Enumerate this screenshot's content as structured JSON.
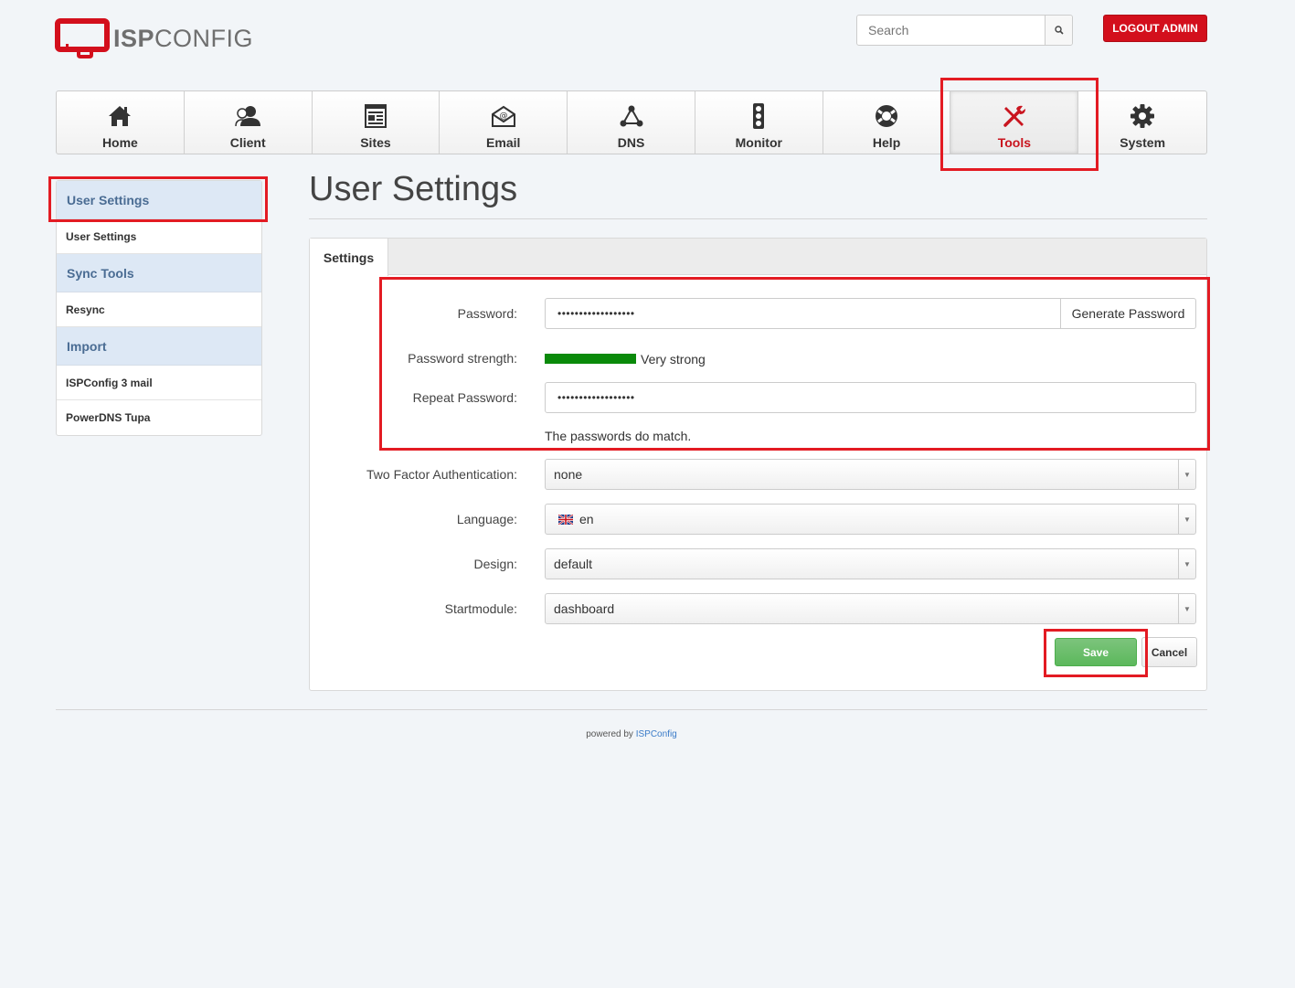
{
  "header": {
    "logo_bold": "ISP",
    "logo_light": "CONFIG",
    "search_placeholder": "Search",
    "logout_label": "LOGOUT ADMIN"
  },
  "nav": {
    "items": [
      {
        "label": "Home",
        "icon": "home-icon"
      },
      {
        "label": "Client",
        "icon": "client-icon"
      },
      {
        "label": "Sites",
        "icon": "sites-icon"
      },
      {
        "label": "Email",
        "icon": "email-icon"
      },
      {
        "label": "DNS",
        "icon": "dns-icon"
      },
      {
        "label": "Monitor",
        "icon": "monitor-icon"
      },
      {
        "label": "Help",
        "icon": "help-icon"
      },
      {
        "label": "Tools",
        "icon": "tools-icon",
        "active": true
      },
      {
        "label": "System",
        "icon": "gear-icon"
      }
    ]
  },
  "sidebar": {
    "sections": [
      {
        "title": "User Settings",
        "items": [
          "User Settings"
        ]
      },
      {
        "title": "Sync Tools",
        "items": [
          "Resync"
        ]
      },
      {
        "title": "Import",
        "items": [
          "ISPConfig 3 mail",
          "PowerDNS Tupa"
        ]
      }
    ]
  },
  "main": {
    "title": "User Settings",
    "tab": "Settings",
    "form": {
      "password_label": "Password:",
      "password_value": "••••••••••••••••••",
      "generate_label": "Generate Password",
      "strength_label": "Password strength:",
      "strength_text": "Very strong",
      "strength_fraction": 1.0,
      "repeat_label": "Repeat Password:",
      "repeat_value": "••••••••••••••••••",
      "match_text": "The passwords do match.",
      "twofa_label": "Two Factor Authentication:",
      "twofa_value": "none",
      "language_label": "Language:",
      "language_value": "en",
      "design_label": "Design:",
      "design_value": "default",
      "startmodule_label": "Startmodule:",
      "startmodule_value": "dashboard",
      "save_label": "Save",
      "cancel_label": "Cancel"
    }
  },
  "footer": {
    "prefix": "powered by",
    "link": "ISPConfig"
  },
  "colors": {
    "accent_red": "#d30f1c",
    "highlight_red": "#e31b23",
    "strength_green": "#0a8a0a",
    "save_green": "#5cb85c",
    "sidebar_head_bg": "#dde8f5"
  }
}
